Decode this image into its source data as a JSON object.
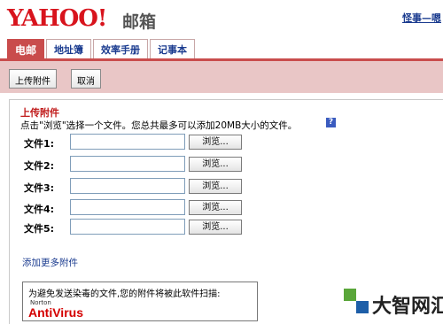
{
  "header": {
    "logo_text": "YAHOO!",
    "service_name": "邮箱",
    "top_link": "怪事—嗯"
  },
  "tabs": [
    {
      "label": "电邮",
      "active": true
    },
    {
      "label": "地址簿",
      "active": false
    },
    {
      "label": "效率手册",
      "active": false
    },
    {
      "label": "记事本",
      "active": false
    }
  ],
  "toolbar": {
    "attach_label": "上传附件",
    "cancel_label": "取消"
  },
  "upload": {
    "title": "上传附件",
    "hint": "点击\"浏览\"选择一个文件。您总共最多可以添加20MB大小的文件。",
    "help_icon": "?",
    "browse_label": "浏览...",
    "files": [
      {
        "label": "文件1:",
        "value": ""
      },
      {
        "label": "文件2:",
        "value": ""
      },
      {
        "label": "文件3:",
        "value": ""
      },
      {
        "label": "文件4:",
        "value": ""
      },
      {
        "label": "文件5:",
        "value": ""
      }
    ],
    "more_link": "添加更多附件"
  },
  "antivirus": {
    "notice": "为避免发送染毒的文件,您的附件将被此软件扫描:",
    "vendor": "Norton",
    "product": "AntiVirus"
  },
  "watermark": {
    "text": "大智网汇"
  },
  "colors": {
    "brand_red": "#d8141d",
    "tab_active": "#c94c4c",
    "toolbar_bg": "#e9c6c6",
    "link_blue": "#1a3b8f"
  }
}
